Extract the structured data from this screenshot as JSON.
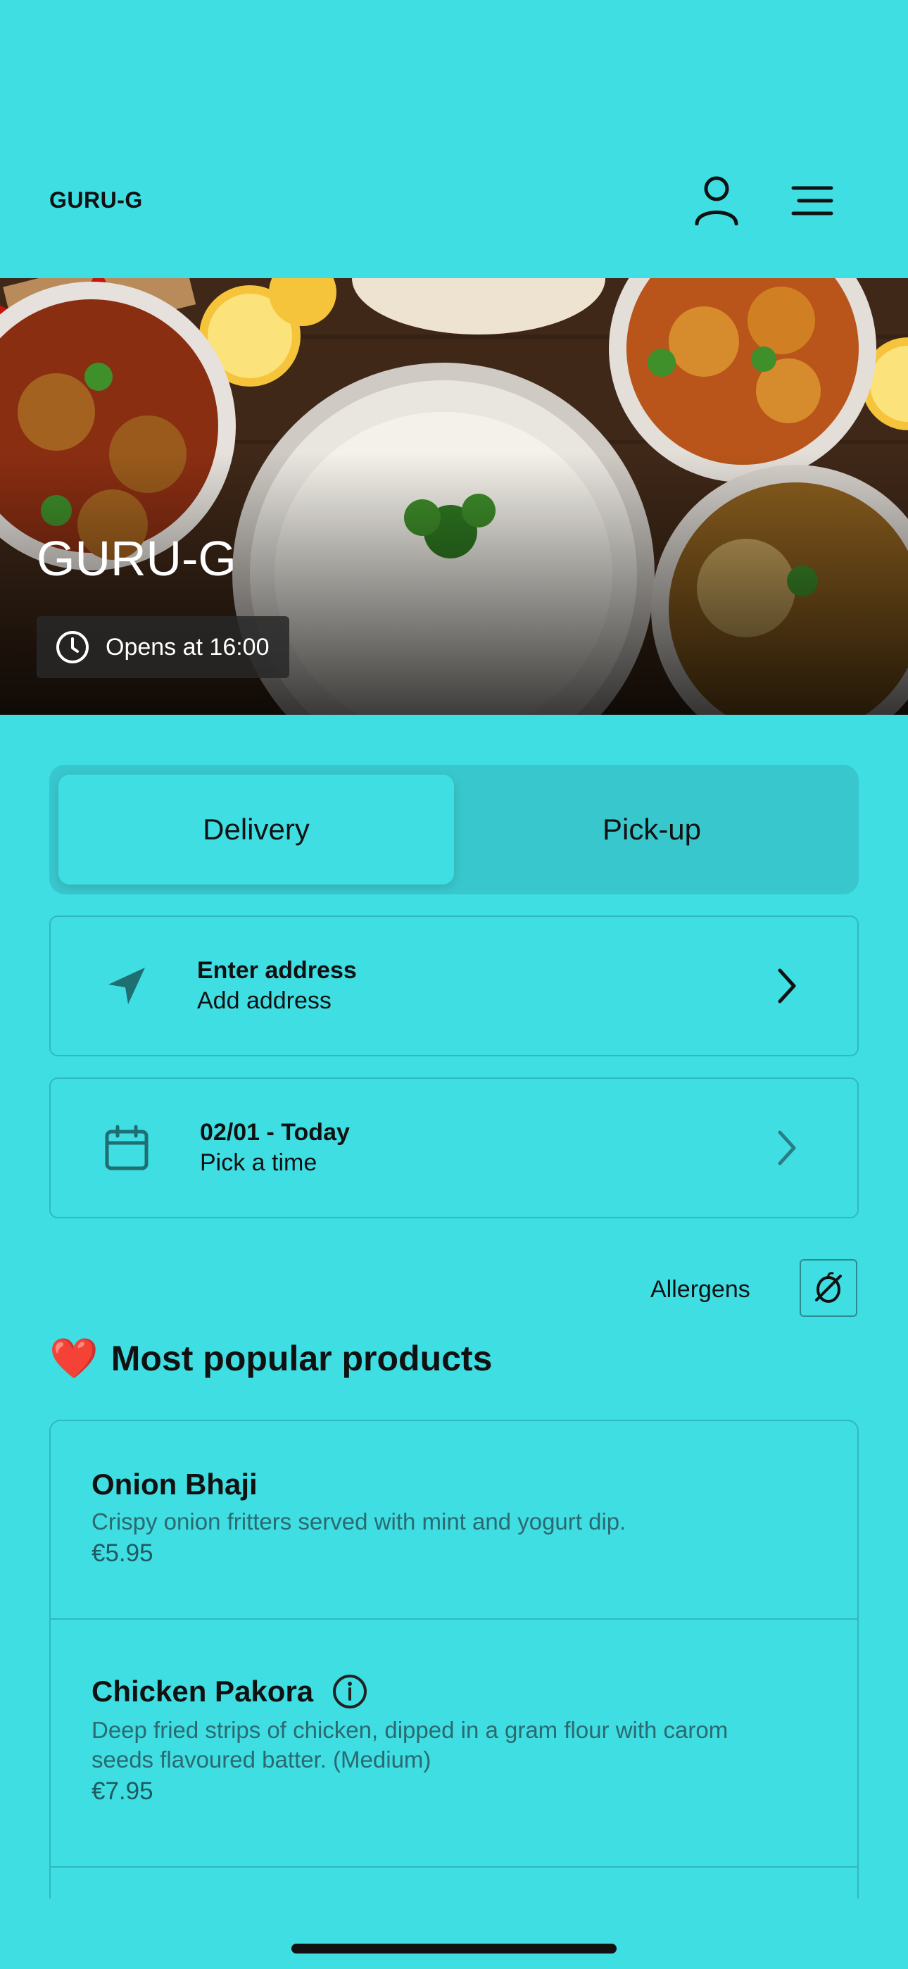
{
  "header": {
    "brand": "GURU-G",
    "user_icon": "user-icon",
    "menu_icon": "menu-icon"
  },
  "hero": {
    "title": "GURU-G",
    "hours": "Opens at 16:00",
    "clock_icon": "clock-icon"
  },
  "order_mode": {
    "tabs": [
      {
        "label": "Delivery",
        "selected": true
      },
      {
        "label": "Pick-up",
        "selected": false
      }
    ]
  },
  "address_card": {
    "title": "Enter address",
    "subtitle": "Add address",
    "icon": "location-arrow-icon"
  },
  "time_card": {
    "title": "02/01 - Today",
    "subtitle": "Pick a time",
    "icon": "calendar-icon"
  },
  "allergens": {
    "label": "Allergens",
    "icon": "allergen-filter-icon"
  },
  "popular": {
    "emoji": "❤️",
    "title": "Most popular products",
    "products": [
      {
        "name": "Onion Bhaji",
        "description": "Crispy onion fritters served with mint and yogurt dip.",
        "price": "€5.95"
      },
      {
        "name": "Chicken Pakora",
        "description": "Deep fried strips of chicken, dipped in a gram flour with carom seeds flavoured batter. (Medium)",
        "price": "€7.95"
      }
    ]
  },
  "colors": {
    "background": "#3FDEE3",
    "toggle_track": "#38C7CD",
    "border": "#2fb9be"
  }
}
